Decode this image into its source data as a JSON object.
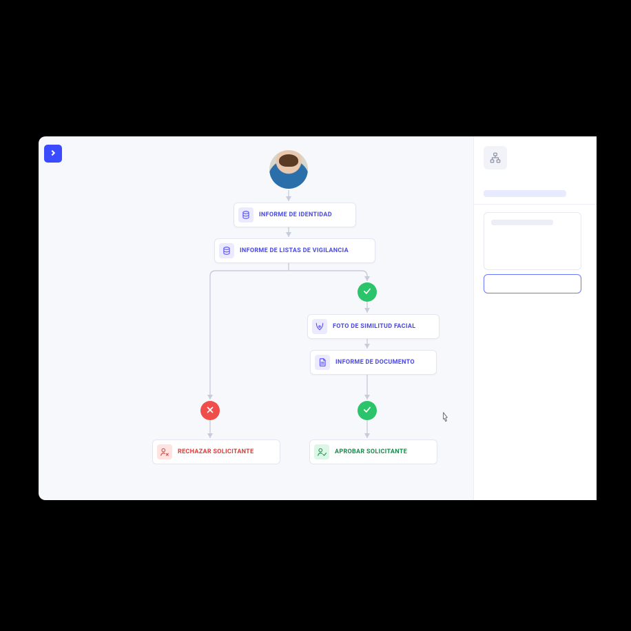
{
  "flow": {
    "nodes": {
      "identity": {
        "label": "INFORME DE IDENTIDAD",
        "icon": "identity-report-icon"
      },
      "watchlist": {
        "label": "INFORME DE LISTAS DE VIGILANCIA",
        "icon": "watchlist-report-icon"
      },
      "facial": {
        "label": "FOTO DE SIMILITUD FACIAL",
        "icon": "facial-similarity-icon"
      },
      "document": {
        "label": "INFORME DE DOCUMENTO",
        "icon": "document-report-icon"
      }
    },
    "terminals": {
      "reject": {
        "label": "RECHAZAR SOLICITANTE",
        "icon": "reject-user-icon"
      },
      "approve": {
        "label": "APROBAR SOLICITANTE",
        "icon": "approve-user-icon"
      }
    },
    "status": {
      "ok": "pass",
      "bad": "fail"
    }
  },
  "colors": {
    "accent": "#3b4bff",
    "pass": "#2bc46a",
    "fail": "#ef4e4a",
    "node_text": "#4a49e0",
    "approve_text": "#188a4a",
    "reject_text": "#d6403b"
  }
}
